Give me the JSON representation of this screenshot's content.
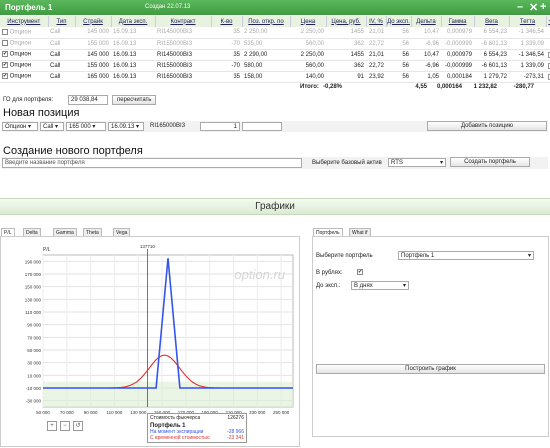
{
  "window": {
    "title": "Портфель 1",
    "created": "Создан 22.07.13"
  },
  "table": {
    "headers": [
      "Инструмент",
      "Тип",
      "Страйк",
      "Дата эксп.",
      "Контракт",
      "К-во",
      "Поз. откр. по",
      "Цена",
      "Цена, руб.",
      "IV, %",
      "До эксп.",
      "Дельта",
      "Гамма",
      "Вега",
      "Тетта",
      "+/-"
    ],
    "rows": [
      {
        "dim": true,
        "checked": false,
        "cells": [
          "Опцион",
          "Call",
          "145 000",
          "16.09.13",
          "RI145000BI3",
          "35",
          "2 250,00",
          "2 250,00",
          "1455",
          "21,01",
          "56",
          "10,47",
          "0,000979",
          "6 554,23",
          "-1 346,54"
        ]
      },
      {
        "dim": true,
        "checked": false,
        "cells": [
          "Опцион",
          "Call",
          "155 000",
          "16.09.13",
          "RI155000BI3",
          "-70",
          "535,00",
          "560,00",
          "362",
          "22,72",
          "56",
          "-6,96",
          "-0,000999",
          "-6 601,13",
          "1 339,09"
        ]
      },
      {
        "dim": false,
        "checked": true,
        "cells": [
          "Опцион",
          "Call",
          "145 000",
          "16.09.13",
          "RI145000BI3",
          "35",
          "2 290,00",
          "2 250,00",
          "1455",
          "21,01",
          "56",
          "10,47",
          "0,000979",
          "6 554,23",
          "-1 346,54"
        ]
      },
      {
        "dim": false,
        "checked": true,
        "cells": [
          "Опцион",
          "Call",
          "155 000",
          "16.09.13",
          "RI155000BI3",
          "-70",
          "580,00",
          "560,00",
          "362",
          "22,72",
          "56",
          "-6,96",
          "-0,000999",
          "-6 601,13",
          "1 339,09"
        ]
      },
      {
        "dim": false,
        "checked": true,
        "cells": [
          "Опцион",
          "Call",
          "165 000",
          "16.09.13",
          "RI165000BI3",
          "35",
          "158,00",
          "140,00",
          "91",
          "23,92",
          "56",
          "1,05",
          "0,000184",
          "1 279,72",
          "-273,31"
        ]
      }
    ],
    "totals": {
      "label": "Итого:",
      "pct": "-0,28%",
      "delta": "4,55",
      "gamma": "0,000164",
      "vega": "1 232,82",
      "theta": "-280,77"
    }
  },
  "go": {
    "label": "ГО для портфеля:",
    "value": "29 038,84",
    "recalc": "пересчитать"
  },
  "new_position": {
    "title": "Новая позиция",
    "instrument": "Опцион",
    "type": "Call",
    "strike": "165 000",
    "date": "16.09.13",
    "contract": "RI165000BI3",
    "qty": "1",
    "add_button": "Добавить позицию"
  },
  "new_portfolio": {
    "title": "Создание нового портфеля",
    "name_placeholder": "Введите название портфеля",
    "base_label": "Выберите базовый актив",
    "base_value": "RTS",
    "create_button": "Создать портфель"
  },
  "charts_section": {
    "title": "Графики"
  },
  "chart_tabs": [
    "P/L",
    "Delta",
    "Gamma",
    "Theta",
    "Vega"
  ],
  "right_tabs": [
    "Портфель",
    "What if"
  ],
  "right_panel": {
    "portfolio_label": "Выберите портфель",
    "portfolio_value": "Портфель 1",
    "rub_label": "В рублях:",
    "to_exp_label": "До эксп.:",
    "to_exp_value": "В днях",
    "build_button": "Построить график"
  },
  "chart_data": {
    "type": "line",
    "ylabel": "P/L",
    "marker_x": 137710,
    "marker_label": "137710",
    "xlim": [
      50000,
      260000
    ],
    "ylim": [
      -40000,
      200000
    ],
    "x_ticks": [
      "50 000",
      "70 000",
      "90 000",
      "110 000",
      "130 000",
      "150 000",
      "170 000",
      "190 000",
      "210 000",
      "230 000",
      "250 000"
    ],
    "y_ticks": [
      "190 000",
      "170 000",
      "150 000",
      "130 000",
      "110 000",
      "90 000",
      "70 000",
      "50 000",
      "30 000",
      "10 000",
      "-10 000",
      "-30 000"
    ],
    "y_tick_vals": [
      190000,
      170000,
      150000,
      130000,
      110000,
      90000,
      70000,
      50000,
      30000,
      10000,
      -10000,
      -30000
    ],
    "series": [
      {
        "name": "На момент экспирации",
        "color": "#3355ee",
        "x": [
          50000,
          145000,
          155000,
          165000,
          260000
        ],
        "y": [
          -10000,
          -10000,
          340000,
          -10000,
          -10000
        ]
      },
      {
        "name": "С временной стоимостью",
        "color": "#dd3333",
        "x": [
          50000,
          100000,
          120000,
          135000,
          145000,
          155000,
          165000,
          180000,
          200000,
          260000
        ],
        "y": [
          -10000,
          -8000,
          0,
          18000,
          33000,
          42000,
          35000,
          12000,
          -5000,
          -10000
        ]
      }
    ],
    "watermark": "option.ru",
    "tooltip": {
      "label": "Стоимость фьючерса",
      "value": "126276",
      "title": "Портфель 1",
      "s1": "На момент экспирации",
      "v1": "-28 966",
      "s2": "С временной стоимостью",
      "v2": "-23 341"
    }
  },
  "zoom": {
    "icons": [
      "zoom-in-icon",
      "zoom-out-icon",
      "zoom-reset-icon"
    ]
  }
}
